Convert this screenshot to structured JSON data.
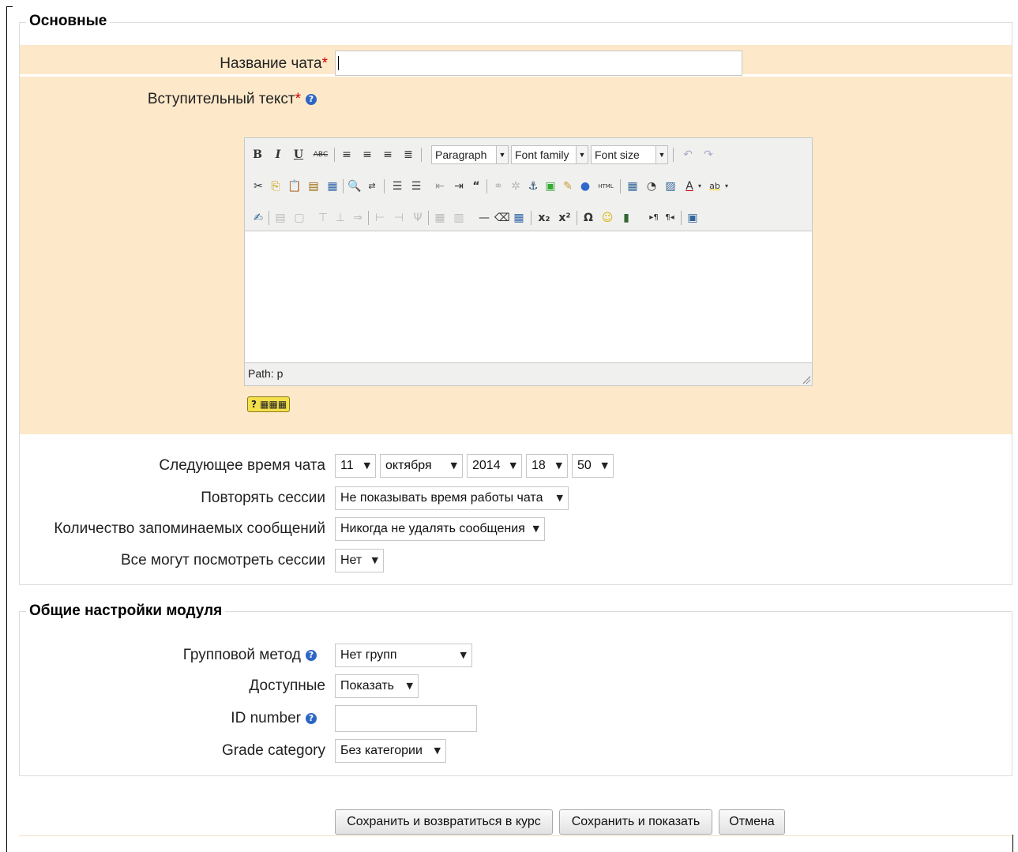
{
  "sections": {
    "general": {
      "legend": "Основные",
      "chat_name": {
        "label": "Название чата",
        "value": ""
      },
      "intro_text": {
        "label": "Вступительный текст"
      },
      "editor": {
        "paragraph_select": "Paragraph",
        "font_family_select": "Font family",
        "font_size_select": "Font size",
        "path": "Path: p",
        "bold": "B",
        "italic": "I",
        "underline": "U",
        "strike": "ABC",
        "text_color": "A",
        "bg_color": "ab",
        "omega": "Ω",
        "subscript": "x₂",
        "superscript": "x²",
        "html": "HTML",
        "keyboard_help": "?"
      },
      "next_time": {
        "label": "Следующее время чата",
        "day": "11",
        "month": "октября",
        "year": "2014",
        "hour": "18",
        "minute": "50"
      },
      "repeat_sessions": {
        "label": "Повторять сессии",
        "value": "Не показывать время работы чата"
      },
      "keep_messages": {
        "label": "Количество запоминаемых сообщений",
        "value": "Никогда не удалять сообщения"
      },
      "view_sessions": {
        "label": "Все могут посмотреть сессии",
        "value": "Нет"
      }
    },
    "module": {
      "legend": "Общие настройки модуля",
      "group_mode": {
        "label": "Групповой метод",
        "value": "Нет групп"
      },
      "visible": {
        "label": "Доступные",
        "value": "Показать"
      },
      "id_number": {
        "label": "ID number",
        "value": ""
      },
      "grade_category": {
        "label": "Grade category",
        "value": "Без категории"
      }
    }
  },
  "buttons": {
    "save_return": "Сохранить и возвратиться в курс",
    "save_display": "Сохранить и показать",
    "cancel": "Отмена"
  },
  "icons": {
    "help": "help-icon",
    "dropdown": "chevron-down-icon"
  }
}
